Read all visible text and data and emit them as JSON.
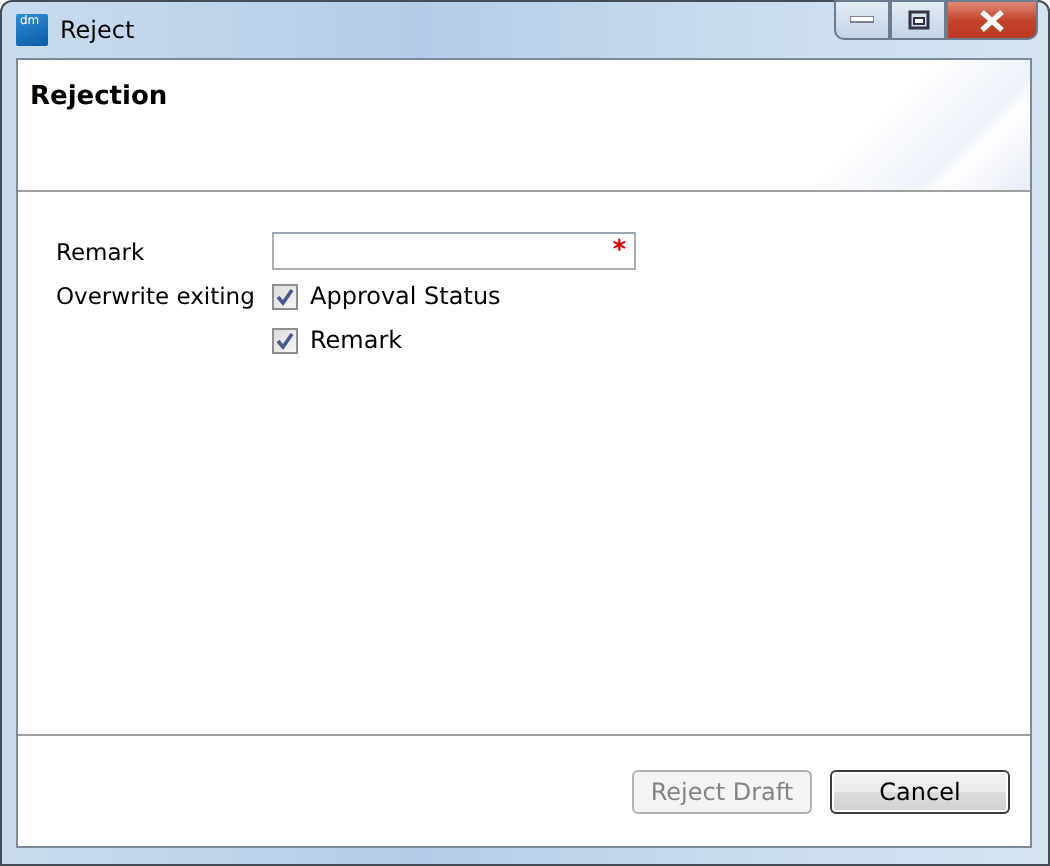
{
  "window": {
    "title": "Reject",
    "logo": "dm"
  },
  "header": {
    "title": "Rejection"
  },
  "form": {
    "remark": {
      "label": "Remark",
      "required_mark": "*"
    },
    "overwrite": {
      "label": "Overwrite exiting",
      "options": [
        {
          "label": "Approval Status",
          "checked": true
        },
        {
          "label": "Remark",
          "checked": true
        }
      ]
    }
  },
  "buttons": [
    {
      "label": "Reject Draft",
      "disabled": true,
      "kind": "normal"
    },
    {
      "label": "Cancel",
      "disabled": false,
      "kind": "default"
    }
  ]
}
